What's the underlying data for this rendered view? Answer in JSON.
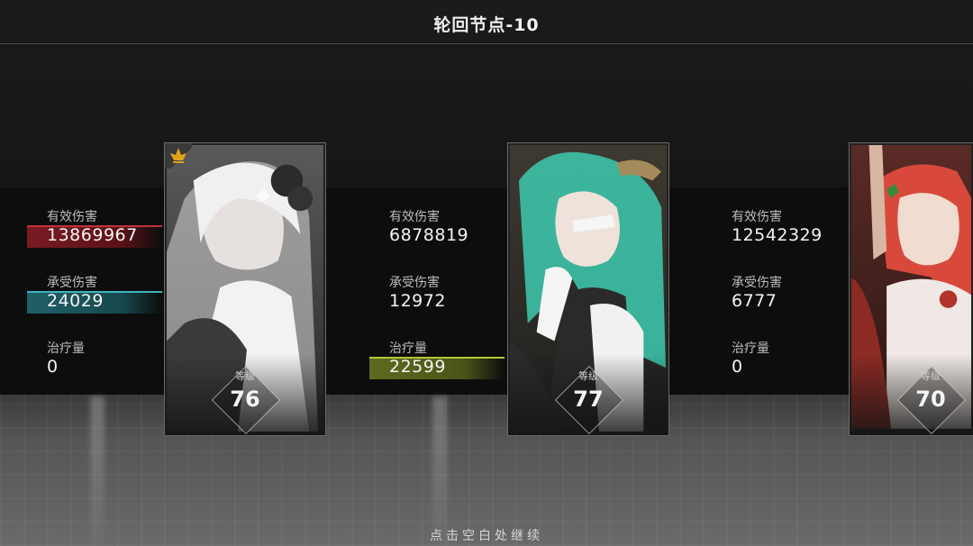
{
  "header": {
    "title": "轮回节点-10"
  },
  "characters": [
    {
      "stats": [
        {
          "label": "有效伤害",
          "value": "13869967"
        },
        {
          "label": "承受伤害",
          "value": "24029"
        },
        {
          "label": "治疗量",
          "value": "0"
        }
      ],
      "level_label": "等级",
      "level": "76",
      "accent": "#c0323b"
    },
    {
      "stats": [
        {
          "label": "有效伤害",
          "value": "6878819"
        },
        {
          "label": "承受伤害",
          "value": "12972"
        },
        {
          "label": "治疗量",
          "value": "22599"
        }
      ],
      "level_label": "等级",
      "level": "77",
      "accent": "#b7c43a"
    },
    {
      "stats": [
        {
          "label": "有效伤害",
          "value": "12542329"
        },
        {
          "label": "承受伤害",
          "value": "6777"
        },
        {
          "label": "治疗量",
          "value": "0"
        }
      ],
      "level_label": "等级",
      "level": "70",
      "accent": "#3fb3bf"
    }
  ],
  "footer": {
    "hint": "点击空白处继续"
  }
}
